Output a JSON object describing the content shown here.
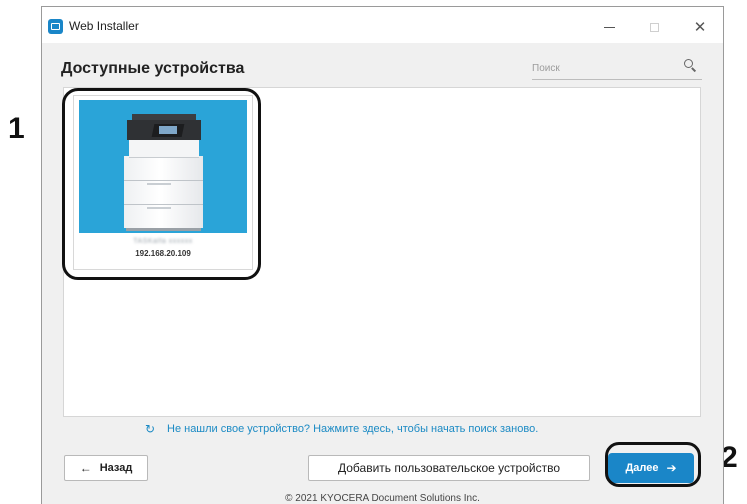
{
  "window": {
    "title": "Web Installer",
    "controls": {
      "minimize_icon": "minimize-icon",
      "maximize_icon": "maximize-icon",
      "close_icon": "close-icon",
      "close_glyph": "✕"
    }
  },
  "page": {
    "heading": "Доступные устройства"
  },
  "search": {
    "placeholder": "Поиск",
    "value": "",
    "icon": "search-icon"
  },
  "devices": [
    {
      "name": "TASKalfa xxxxxx",
      "ip": "192.168.20.109",
      "selected": true,
      "image_bg_color": "#2aa4d8"
    }
  ],
  "refresh": {
    "icon": "refresh-icon",
    "glyph": "↻",
    "text": "Не нашли свое устройство? Нажмите здесь, чтобы начать поиск заново."
  },
  "buttons": {
    "back_label": "Назад",
    "back_arrow": "←",
    "add_device_label": "Добавить пользовательское устройство",
    "next_label": "Далее",
    "next_arrow": "➔"
  },
  "callouts": {
    "first": "1",
    "second": "2"
  },
  "footer": {
    "copyright": "© 2021 KYOCERA Document Solutions Inc."
  },
  "colors": {
    "accent": "#1a86c8",
    "link": "#1b8ac4",
    "device_bg": "#2aa4d8",
    "window_bg": "#f0f0f0"
  }
}
